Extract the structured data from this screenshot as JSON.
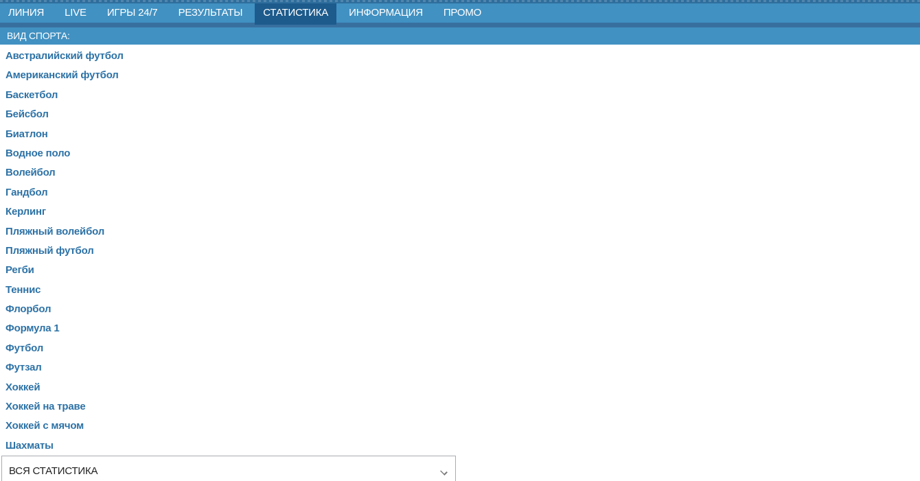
{
  "colors": {
    "nav_bg": "#4191c2",
    "nav_active_bg": "#1d5b8c",
    "nav_divider": "#37709f",
    "top_strip": "#2e6e9d",
    "sport_bar_bg": "#4191c2",
    "sport_link": "#2d72a6",
    "select_border": "#a9abb0",
    "select_text": "#1f1f1f"
  },
  "nav": {
    "tabs": [
      {
        "label": "ЛИНИЯ",
        "active": false
      },
      {
        "label": "LIVE",
        "active": false
      },
      {
        "label": "ИГРЫ 24/7",
        "active": false
      },
      {
        "label": "РЕЗУЛЬТАТЫ",
        "active": false
      },
      {
        "label": "СТАТИСТИКА",
        "active": true
      },
      {
        "label": "ИНФОРМАЦИЯ",
        "active": false
      },
      {
        "label": "ПРОМО",
        "active": false
      }
    ]
  },
  "sports_header": {
    "label": "ВИД СПОРТА:"
  },
  "sports": {
    "items": [
      "Австралийский футбол",
      "Американский футбол",
      "Баскетбол",
      "Бейсбол",
      "Биатлон",
      "Водное поло",
      "Волейбол",
      "Гандбол",
      "Керлинг",
      "Пляжный волейбол",
      "Пляжный футбол",
      "Регби",
      "Теннис",
      "Флорбол",
      "Формула 1",
      "Футбол",
      "Футзал",
      "Хоккей",
      "Хоккей на траве",
      "Хоккей с мячом",
      "Шахматы"
    ]
  },
  "filter": {
    "selected_value": "ВСЯ СТАТИСТИКА",
    "chevron_icon": "chevron-down"
  }
}
